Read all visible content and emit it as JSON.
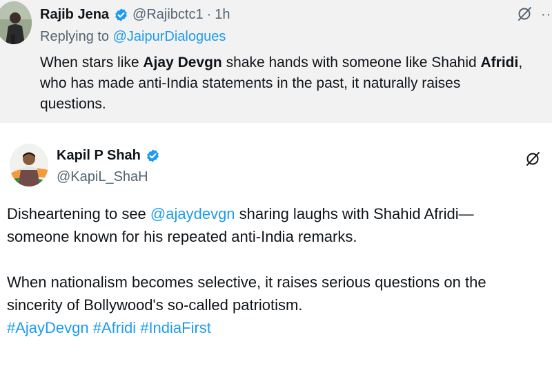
{
  "reply_tweet": {
    "author_name": "Rajib Jena",
    "handle": "@Rajibctc1",
    "separator": "·",
    "time": "1h",
    "replying_prefix": "Replying to",
    "replying_to": "@JaipurDialogues",
    "text_1": "When stars like ",
    "text_2": "Ajay Devgn",
    "text_3": " shake hands with someone like Shahid ",
    "text_4": "Afridi",
    "text_5": ",",
    "text_6": "who has made anti-India statements in the past, it naturally raises",
    "text_7": "questions."
  },
  "main_tweet": {
    "author_name": "Kapil P Shah",
    "handle": "@KapiL_ShaH",
    "line1_a": "Disheartening to see ",
    "line1_mention": "@ajaydevgn",
    "line1_b": " sharing laughs with Shahid Afridi—",
    "line2": "someone known for his repeated anti-India remarks.",
    "line3": "When nationalism becomes selective, it raises serious questions on the",
    "line4": "sincerity of Bollywood's so-called patriotism.",
    "hashtags": "#AjayDevgn #Afridi #IndiaFirst"
  },
  "colors": {
    "link": "#1d9bf0",
    "secondary_text": "#536471",
    "primary_text": "#0f1419",
    "reply_background": "#f2f2f2"
  },
  "icons": {
    "verified": "verified-badge-icon",
    "grok": "grok-icon",
    "more": "more-icon"
  }
}
